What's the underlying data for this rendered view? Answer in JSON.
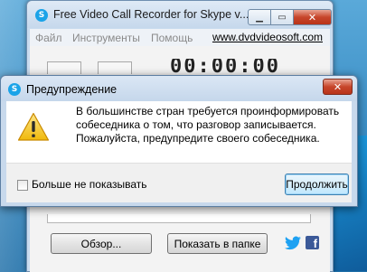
{
  "app": {
    "title": "Free Video Call Recorder for Skype v...",
    "menu": [
      "Файл",
      "Инструменты",
      "Помощь"
    ],
    "site_link": "www.dvdvideosoft.com",
    "timer": "00:00:00",
    "browse_label": "Обзор...",
    "show_folder_label": "Показать в папке",
    "minimize_glyph": "▁",
    "maximize_glyph": "▭",
    "close_glyph": "✕",
    "facebook_glyph": "f",
    "skype_glyph": "S"
  },
  "dialog": {
    "title": "Предупреждение",
    "message": "В большинстве стран требуется проинформировать собеседника о том, что разговор записывается. Пожалуйста, предупредите своего собеседника.",
    "checkbox_label": "Больше не показывать",
    "checkbox_checked": false,
    "continue_label": "Продолжить",
    "close_glyph": "✕",
    "warning_glyph": "!"
  },
  "colors": {
    "accent_skype": "#1aa3e8",
    "close_red": "#c7452b",
    "twitter_blue": "#1da1f2",
    "facebook_blue": "#3b5998",
    "warning_yellow": "#f3c623"
  },
  "icons": {
    "app_icon": "skype-icon",
    "dialog_icon": "skype-icon",
    "warning": "warning-icon",
    "twitter": "twitter-icon",
    "facebook": "facebook-icon"
  }
}
